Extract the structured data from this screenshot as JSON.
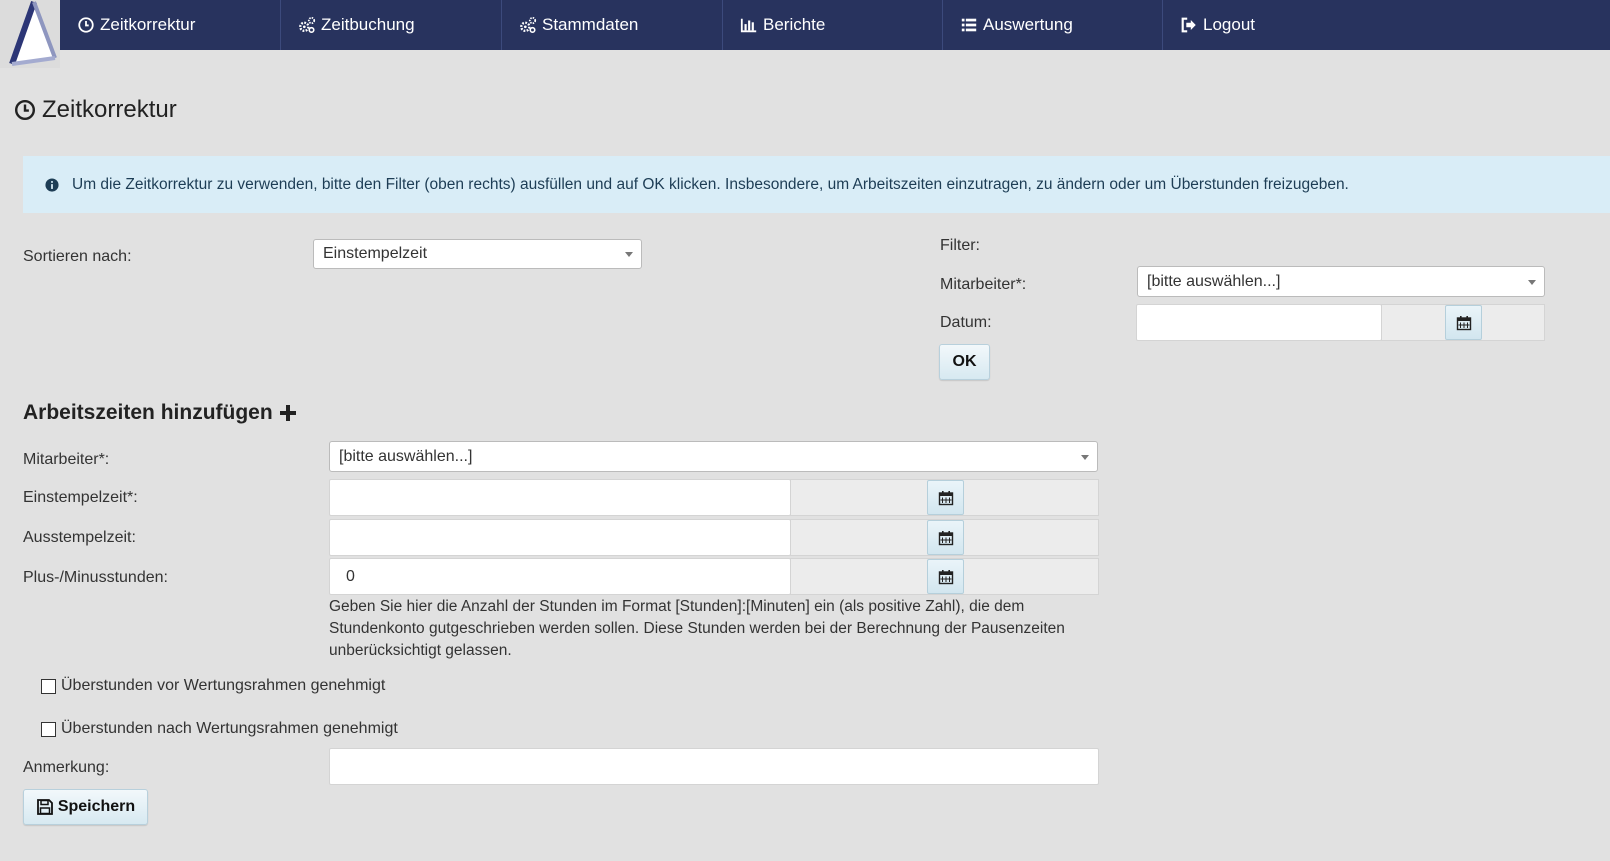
{
  "nav": {
    "items": [
      {
        "label": "Zeitkorrektur",
        "icon": "clock-icon"
      },
      {
        "label": "Zeitbuchung",
        "icon": "cogs-icon"
      },
      {
        "label": "Stammdaten",
        "icon": "cogs-icon"
      },
      {
        "label": "Berichte",
        "icon": "bar-chart-icon"
      },
      {
        "label": "Auswertung",
        "icon": "list-icon"
      },
      {
        "label": "Logout",
        "icon": "logout-icon"
      }
    ]
  },
  "page": {
    "title": "Zeitkorrektur",
    "info": "Um die Zeitkorrektur zu verwenden, bitte den Filter (oben rechts) ausfüllen und auf OK klicken. Insbesondere, um Arbeitszeiten einzutragen, zu ändern oder um Überstunden freizugeben."
  },
  "sort": {
    "label": "Sortieren nach:",
    "value": "Einstempelzeit"
  },
  "filter": {
    "title": "Filter:",
    "employee_label": "Mitarbeiter*:",
    "employee_value": "[bitte auswählen...]",
    "date_label": "Datum:",
    "date_value": "",
    "ok_label": "OK"
  },
  "form": {
    "title": "Arbeitszeiten hinzufügen",
    "employee_label": "Mitarbeiter*:",
    "employee_value": "[bitte auswählen...]",
    "clock_in_label": "Einstempelzeit*:",
    "clock_in_value": "",
    "clock_out_label": "Ausstempelzeit:",
    "clock_out_value": "",
    "plus_minus_label": "Plus-/Minusstunden:",
    "plus_minus_value": "0",
    "hint": "Geben Sie hier die Anzahl der Stunden im Format [Stunden]:[Minuten] ein (als positive Zahl), die dem Stundenkonto gutgeschrieben werden sollen. Diese Stunden werden bei der Berechnung der Pausenzeiten unberücksichtigt gelassen.",
    "overtime_before_label": "Überstunden vor Wertungsrahmen genehmigt",
    "overtime_after_label": "Überstunden nach Wertungsrahmen genehmigt",
    "note_label": "Anmerkung:",
    "note_value": "",
    "save_label": "Speichern"
  },
  "colors": {
    "navbar": "#28335e",
    "info_bg": "#d9edf7",
    "page_bg": "#e1e1e1"
  }
}
